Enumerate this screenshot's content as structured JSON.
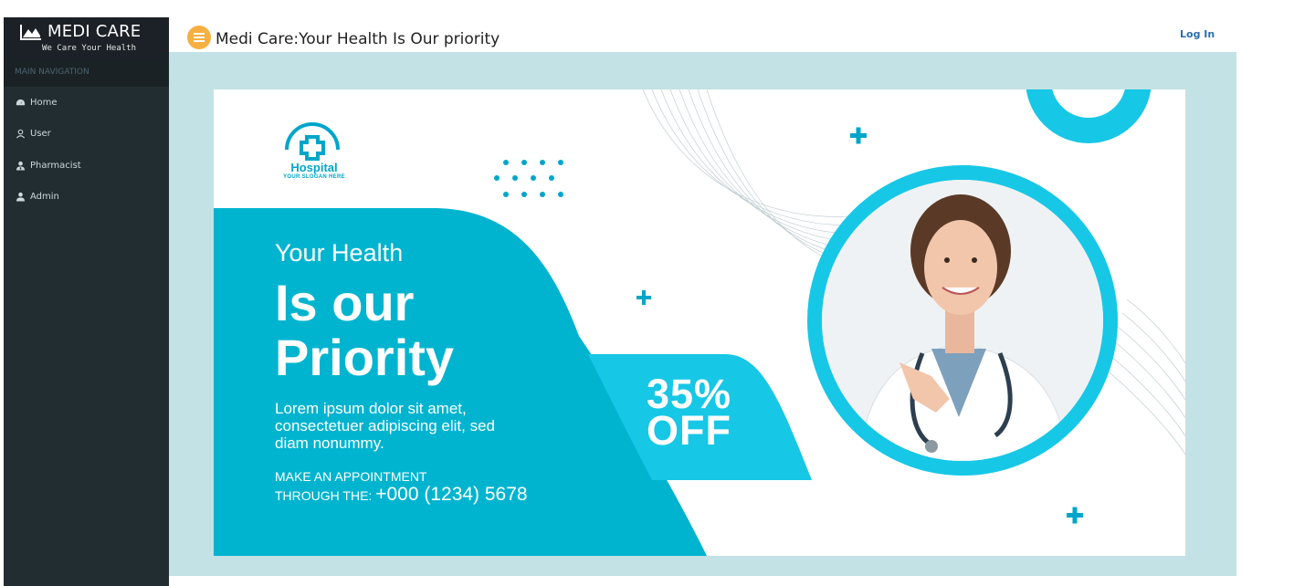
{
  "sidebar": {
    "brand_title": "MEDI CARE",
    "brand_subtitle": "We Care Your Health",
    "nav_header": "MAIN NAVIGATION",
    "items": [
      {
        "label": "Home",
        "icon": "dashboard-icon"
      },
      {
        "label": "User",
        "icon": "user-icon"
      },
      {
        "label": "Pharmacist",
        "icon": "pharmacist-icon"
      },
      {
        "label": "Admin",
        "icon": "admin-icon"
      }
    ]
  },
  "topbar": {
    "title": "Medi Care:Your Health Is Our priority",
    "login_label": "Log In",
    "menu_icon": "hamburger-icon"
  },
  "banner": {
    "logo_name": "Hospital",
    "logo_slogan": "YOUR SLOGAN HERE",
    "headline_1": "Your Health",
    "headline_2": "Is our",
    "headline_3": "Priority",
    "body_line_1": "Lorem ipsum dolor sit amet,",
    "body_line_2": "consectetuer adipiscing elit, sed",
    "body_line_3": "diam nonummy.",
    "appointment_1": "MAKE AN APPOINTMENT",
    "appointment_2": "THROUGH THE:",
    "phone": "+000 (1234) 5678",
    "discount_1": "35%",
    "discount_2": "OFF"
  },
  "colors": {
    "sidebar_bg": "#222d32",
    "accent_teal": "#00b4cf",
    "accent_cyan": "#17c7e6",
    "menu_button": "#f5b041",
    "login_link": "#2a6fb0",
    "content_bg": "#c3e2e5"
  }
}
